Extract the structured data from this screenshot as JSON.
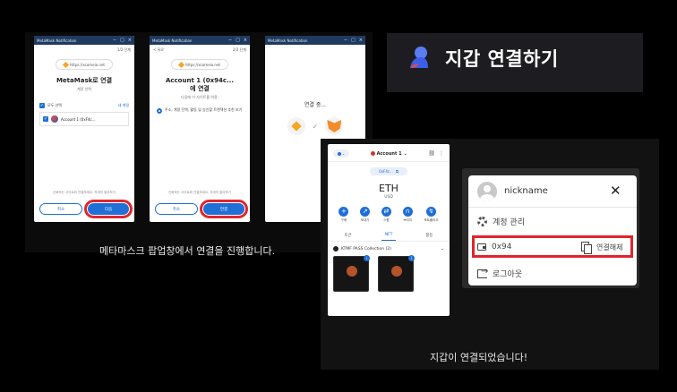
{
  "title_card": {
    "title": "지갑 연결하기"
  },
  "captions": {
    "left": "메타마스크 팝업창에서 연결을 진행합니다.",
    "right": "지갑이 연결되었습니다!"
  },
  "metamask_popups": {
    "window_title": "MetaMask Notification",
    "url": "https://xcomeio.net",
    "step1": {
      "step_label": "1/2 단계",
      "title": "MetaMask로 연결",
      "subtitle": "계정 선택",
      "select_all": "모두 선택",
      "new_account": "새 계정",
      "account": "Account 1 (0xF4c...",
      "footnote": "신뢰하는 사이트와 연결하세요. 자세히 알아보기",
      "cancel": "취소",
      "next": "다음"
    },
    "step2": {
      "step_label": "2/2 단계",
      "back": "< 뒤로",
      "title_line1": "Account 1 (0x94c...",
      "title_line2": "에 연결",
      "subtitle": "다음에 이 사이트를 허용:",
      "permission": "주소, 계정 잔액, 활동 및 승인할 트랜잭션 추천 보기",
      "footnote": "신뢰하는 사이트와 연결하세요. 자세히 알아보기",
      "cancel": "취소",
      "connect": "연결"
    },
    "step3": {
      "connecting": "연결 중..."
    }
  },
  "wallet": {
    "account": "Account 1",
    "address_chip": "0xF4c...",
    "balance": "ETH",
    "currency": "USD",
    "actions": [
      "구매",
      "보내기",
      "스왑",
      "브리지",
      "포트폴리오"
    ],
    "tabs": [
      "토큰",
      "NFT",
      "활동"
    ],
    "active_tab": "NFT",
    "collection": "KTMF PASS Collection (2)"
  },
  "account_menu": {
    "nickname": "nickname",
    "settings": "계정 관리",
    "address": "0x94",
    "disconnect": "연결해제",
    "logout": "로그아웃"
  },
  "colors": {
    "accent": "#1f6fd6",
    "highlight": "#e0262a",
    "titlebar": "#1f3a5f"
  }
}
